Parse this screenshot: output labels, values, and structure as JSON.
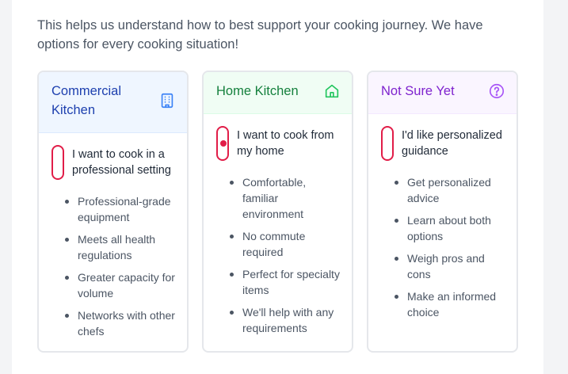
{
  "intro": {
    "line1": "This helps us understand how to best support your cooking journey. We have",
    "line2": "options for every cooking situation!"
  },
  "cards": [
    {
      "title": "Commercial Kitchen",
      "title_line1": "Commercial",
      "title_line2": "Kitchen",
      "icon": "building-icon",
      "accent": "#1e40af",
      "header_bg": "#eff6ff",
      "choice_label": "I want to cook in a professional setting",
      "selected": false,
      "features": [
        "Professional-grade equipment",
        "Meets all health regulations",
        "Greater capacity for volume",
        "Networks with other chefs"
      ]
    },
    {
      "title": "Home Kitchen",
      "icon": "home-icon",
      "accent": "#15803d",
      "header_bg": "#f0fdf4",
      "choice_label": "I want to cook from my home",
      "selected": true,
      "features": [
        "Comfortable, familiar environment",
        "No commute required",
        "Perfect for specialty items",
        "We'll help with any requirements"
      ]
    },
    {
      "title": "Not Sure Yet",
      "icon": "question-circle-icon",
      "accent": "#7e22ce",
      "header_bg": "#faf5ff",
      "choice_label": "I'd like personalized guidance",
      "selected": false,
      "features": [
        "Get personalized advice",
        "Learn about both options",
        "Weigh pros and cons",
        "Make an informed choice"
      ]
    }
  ],
  "colors": {
    "radio": "#e11d48",
    "card_border": "#e5e7eb",
    "page_bg": "#f3f4f6"
  }
}
